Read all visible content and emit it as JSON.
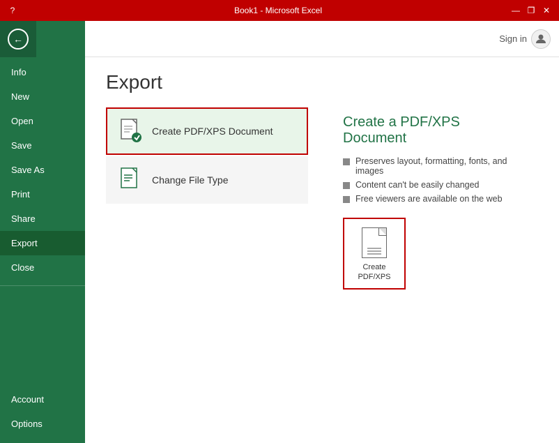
{
  "titlebar": {
    "title": "Book1 - Microsoft Excel",
    "help_btn": "?",
    "minimize_btn": "—",
    "restore_btn": "❐",
    "close_btn": "✕"
  },
  "header": {
    "sign_in_label": "Sign in"
  },
  "sidebar": {
    "back_label": "←",
    "items": [
      {
        "label": "Info",
        "id": "info",
        "active": false
      },
      {
        "label": "New",
        "id": "new",
        "active": false
      },
      {
        "label": "Open",
        "id": "open",
        "active": false
      },
      {
        "label": "Save",
        "id": "save",
        "active": false
      },
      {
        "label": "Save As",
        "id": "save-as",
        "active": false
      },
      {
        "label": "Print",
        "id": "print",
        "active": false
      },
      {
        "label": "Share",
        "id": "share",
        "active": false
      },
      {
        "label": "Export",
        "id": "export",
        "active": true
      },
      {
        "label": "Close",
        "id": "close",
        "active": false
      }
    ],
    "bottom_items": [
      {
        "label": "Account",
        "id": "account"
      },
      {
        "label": "Options",
        "id": "options"
      }
    ]
  },
  "page": {
    "title": "Export",
    "export_options": [
      {
        "label": "Create PDF/XPS Document",
        "id": "create-pdf",
        "selected": true
      },
      {
        "label": "Change File Type",
        "id": "change-file-type",
        "selected": false
      }
    ],
    "detail": {
      "title": "Create a PDF/XPS Document",
      "bullets": [
        "Preserves layout, formatting, fonts, and images",
        "Content can't be easily changed",
        "Free viewers are available on the web"
      ],
      "create_button_label": "Create\nPDF/XPS"
    }
  }
}
